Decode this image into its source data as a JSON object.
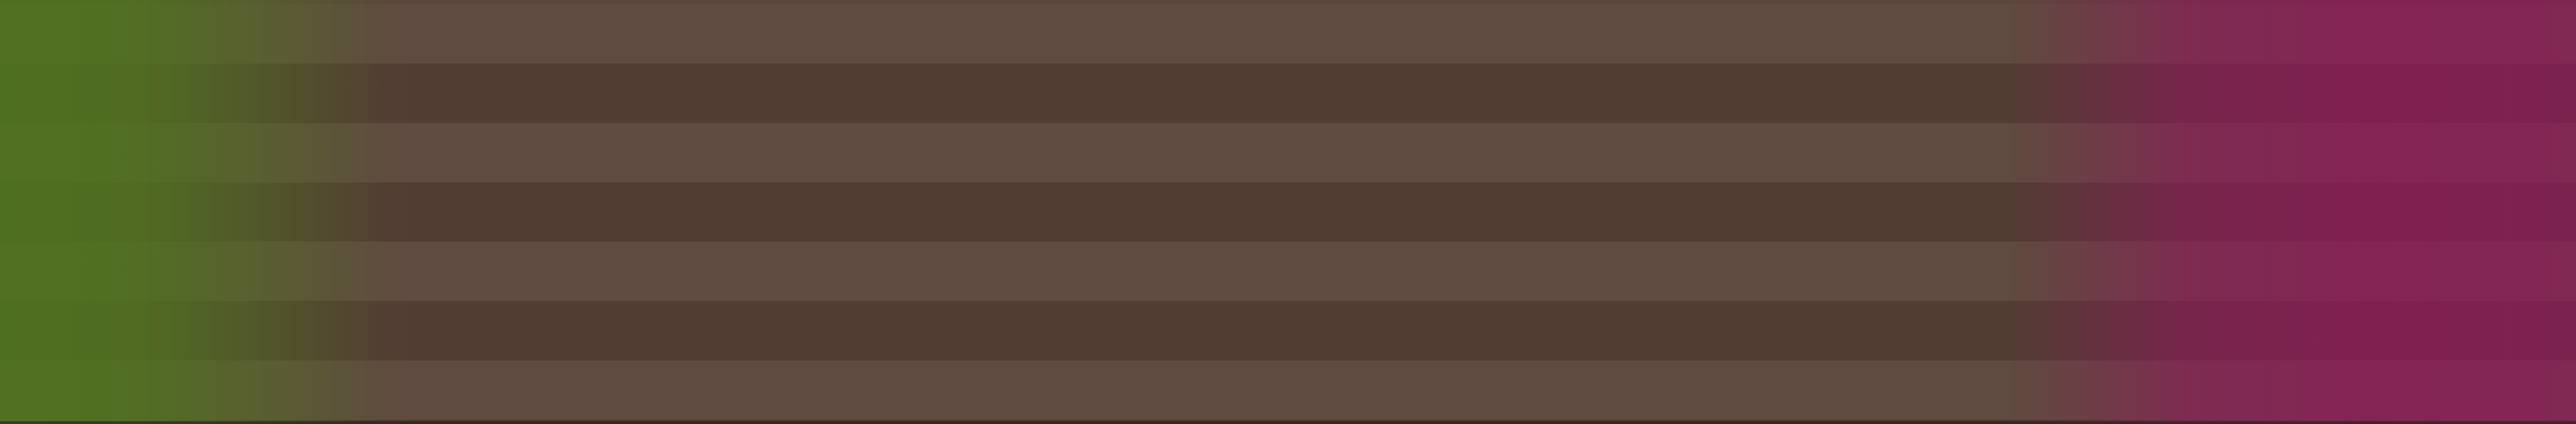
{
  "background": {
    "stripe_light_color": "#5f4b3f",
    "stripe_dark_color": "#523d33",
    "left_tint_color": "#4e761c",
    "right_tint_color": "#96125f",
    "stripe_count": 7
  }
}
